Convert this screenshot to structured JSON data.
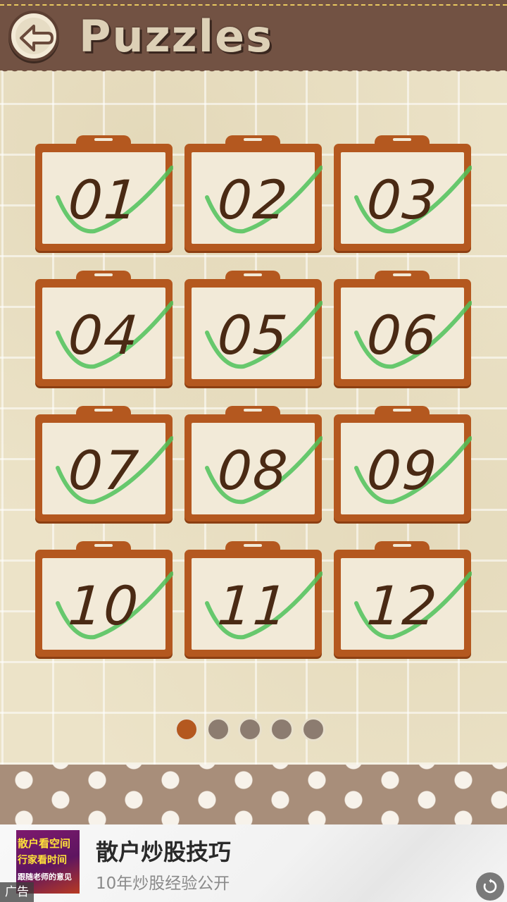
{
  "header": {
    "title": "Puzzles",
    "back_icon": "back-arrow-icon"
  },
  "puzzles": [
    {
      "label": "01",
      "completed": true
    },
    {
      "label": "02",
      "completed": true
    },
    {
      "label": "03",
      "completed": true
    },
    {
      "label": "04",
      "completed": true
    },
    {
      "label": "05",
      "completed": true
    },
    {
      "label": "06",
      "completed": true
    },
    {
      "label": "07",
      "completed": true
    },
    {
      "label": "08",
      "completed": true
    },
    {
      "label": "09",
      "completed": true
    },
    {
      "label": "10",
      "completed": true
    },
    {
      "label": "11",
      "completed": true
    },
    {
      "label": "12",
      "completed": true
    }
  ],
  "pagination": {
    "total_pages": 5,
    "current_page": 1
  },
  "ad": {
    "thumb_line1": "散户看空间",
    "thumb_line2": "行家看时间",
    "thumb_line3": "跟随老师的意见",
    "title": "散户炒股技巧",
    "subtitle": "10年炒股经验公开",
    "tag": "广告",
    "refresh_icon": "refresh-icon"
  },
  "colors": {
    "header_bg": "#725243",
    "card_frame": "#b4581f",
    "card_paper": "#f2ead8",
    "number_ink": "#4a2a14",
    "check_green": "#4fc25a",
    "dot_active": "#b4581f",
    "dot_inactive": "#8c7c70"
  }
}
